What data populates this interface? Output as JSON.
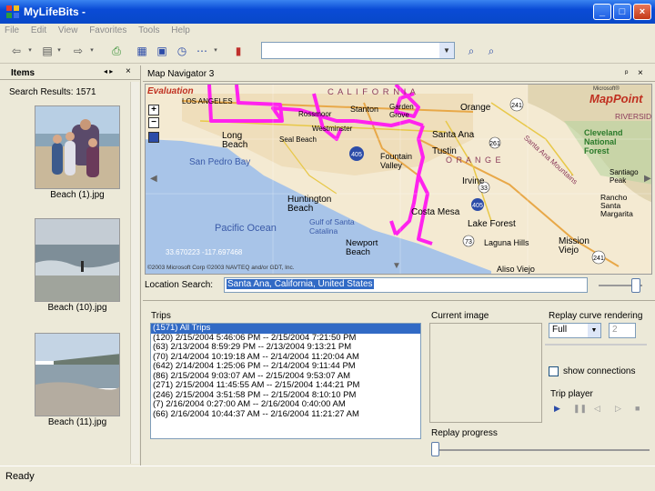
{
  "window": {
    "title": "MyLifeBits -"
  },
  "menu": [
    "File",
    "Edit",
    "View",
    "Favorites",
    "Tools",
    "Help"
  ],
  "items_pane": {
    "tab_label": "Items",
    "search_results": "Search Results: 1571",
    "thumbnails": [
      {
        "label": "Beach (1).jpg"
      },
      {
        "label": "Beach (10).jpg"
      },
      {
        "label": "Beach (11).jpg"
      }
    ]
  },
  "map_pane": {
    "title": "Map Navigator 3",
    "evaluation": "Evaluation",
    "state_label": "C A L I F O R N I A",
    "county_label": "O R A N G E",
    "places": [
      "LOS ANGELES",
      "Rossmoor",
      "Stanton",
      "Garden Grove",
      "Orange",
      "Long Beach",
      "Seal Beach",
      "Westminster",
      "Santa Ana",
      "Fountain Valley",
      "Tustin",
      "Irvine",
      "Huntington Beach",
      "Costa Mesa",
      "Lake Forest",
      "Newport Beach",
      "Laguna Hills",
      "Mission Viejo",
      "Aliso Viejo",
      "San Pedro Bay",
      "Pacific Ocean",
      "Gulf of Santa Catalina",
      "RIVERSIDE",
      "Cleveland National Forest",
      "Rancho Santa Margarita",
      "Santiago Peak",
      "Santa Ana Mountains"
    ],
    "coordinates": "33.670223 -117.697468",
    "copyright": "©2003 Microsoft Corp ©2003 NAVTEQ and/or GDT, Inc.",
    "mappoint_brand": "MapPoint",
    "microsoft": "Microsoft®",
    "zoom_plus": "+",
    "zoom_minus": "−",
    "route_color": "#ff22ee"
  },
  "location_search": {
    "label": "Location Search:",
    "value": "Santa Ana, California, United States"
  },
  "trips": {
    "label": "Trips",
    "items": [
      "(1571) All Trips",
      "(120) 2/15/2004 5:46:06 PM -- 2/15/2004 7:21:50 PM",
      "(63) 2/13/2004 8:59:29 PM -- 2/13/2004 9:13:21 PM",
      "(70) 2/14/2004 10:19:18 AM -- 2/14/2004 11:20:04 AM",
      "(642) 2/14/2004 1:25:06 PM -- 2/14/2004 9:11:44 PM",
      "(86) 2/15/2004 9:03:07 AM -- 2/15/2004 9:53:07 AM",
      "(271) 2/15/2004 11:45:55 AM -- 2/15/2004 1:44:21 PM",
      "(246) 2/15/2004 3:51:58 PM -- 2/15/2004 8:10:10 PM",
      "(7) 2/16/2004 0:27:00 AM -- 2/16/2004 0:40:00 AM",
      "(66) 2/16/2004 10:44:37 AM -- 2/16/2004 11:21:27 AM"
    ]
  },
  "current_image": {
    "label": "Current image"
  },
  "replay": {
    "curve_label": "Replay curve rendering",
    "mode": "Full",
    "stepper_value": "2",
    "show_connections": "show connections",
    "trip_player": "Trip player",
    "progress_label": "Replay progress"
  },
  "status": {
    "text": "Ready"
  }
}
